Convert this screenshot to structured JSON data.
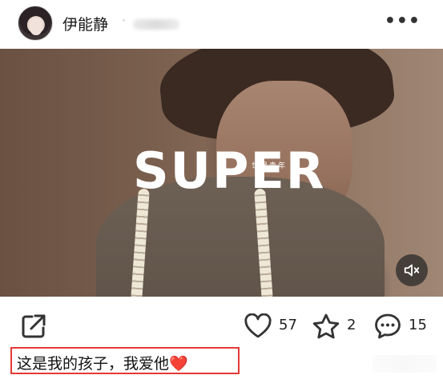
{
  "post": {
    "username": "伊能静",
    "separator": "·",
    "more_label": "•••"
  },
  "media": {
    "brand_title": "SUPER",
    "brand_subtitle": "世界青年",
    "mute_icon": "speaker-muted-icon"
  },
  "actions": {
    "share_icon": "share-icon",
    "like_icon": "heart-outline-icon",
    "like_count": "57",
    "favorite_icon": "star-outline-icon",
    "favorite_count": "2",
    "comment_icon": "comment-bubble-icon",
    "comment_count": "15"
  },
  "caption": {
    "text": "这是我的孩子，我爱他",
    "emoji": "❤️"
  },
  "colors": {
    "highlight_border": "#e53935",
    "text_primary": "#222222"
  }
}
